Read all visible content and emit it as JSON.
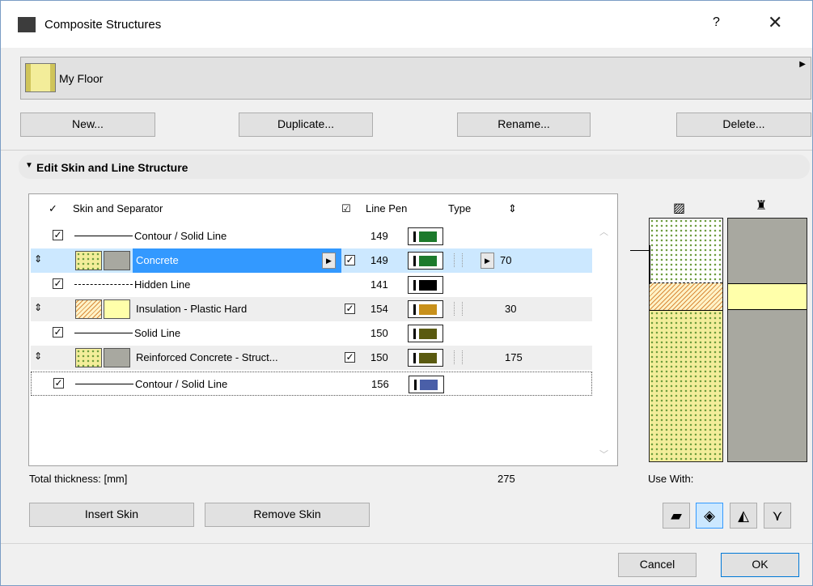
{
  "window": {
    "title": "Composite Structures",
    "help": "?",
    "close": "✕"
  },
  "selector": {
    "name": "My Floor"
  },
  "buttons": {
    "new": "New...",
    "duplicate": "Duplicate...",
    "rename": "Rename...",
    "delete": "Delete..."
  },
  "section": {
    "title": "Edit Skin and Line Structure"
  },
  "grid": {
    "headers": {
      "skin_and_separator": "Skin and Separator",
      "line_pen": "Line Pen",
      "type": "Type"
    },
    "rows": [
      {
        "kind": "line",
        "checked": true,
        "line_style": "solid",
        "name": "Contour / Solid Line",
        "pen": "149",
        "pen_color": "#1c7a2c"
      },
      {
        "kind": "skin",
        "selected": true,
        "name": "Concrete",
        "checked": true,
        "pen": "149",
        "pen_color": "#1c7a2c",
        "thickness": "70"
      },
      {
        "kind": "line",
        "checked": true,
        "line_style": "dashed",
        "name": "Hidden Line",
        "pen": "141",
        "pen_color": "#000000"
      },
      {
        "kind": "skin",
        "name": "Insulation - Plastic Hard",
        "checked": true,
        "pen": "154",
        "pen_color": "#c8901a",
        "thickness": "30"
      },
      {
        "kind": "line",
        "checked": true,
        "line_style": "solid",
        "name": "Solid Line",
        "pen": "150",
        "pen_color": "#5a5a10"
      },
      {
        "kind": "skin",
        "name": "Reinforced Concrete - Struct...",
        "checked": true,
        "pen": "150",
        "pen_color": "#5a5a10",
        "thickness": "175"
      },
      {
        "kind": "line",
        "checked": true,
        "line_style": "solid",
        "name": "Contour / Solid Line",
        "pen": "156",
        "pen_color": "#4a5fa8"
      }
    ]
  },
  "total": {
    "label": "Total thickness: [mm]",
    "value": "275"
  },
  "skin_buttons": {
    "insert": "Insert Skin",
    "remove": "Remove Skin"
  },
  "use_with": {
    "label": "Use With:"
  },
  "dialog_buttons": {
    "cancel": "Cancel",
    "ok": "OK"
  }
}
